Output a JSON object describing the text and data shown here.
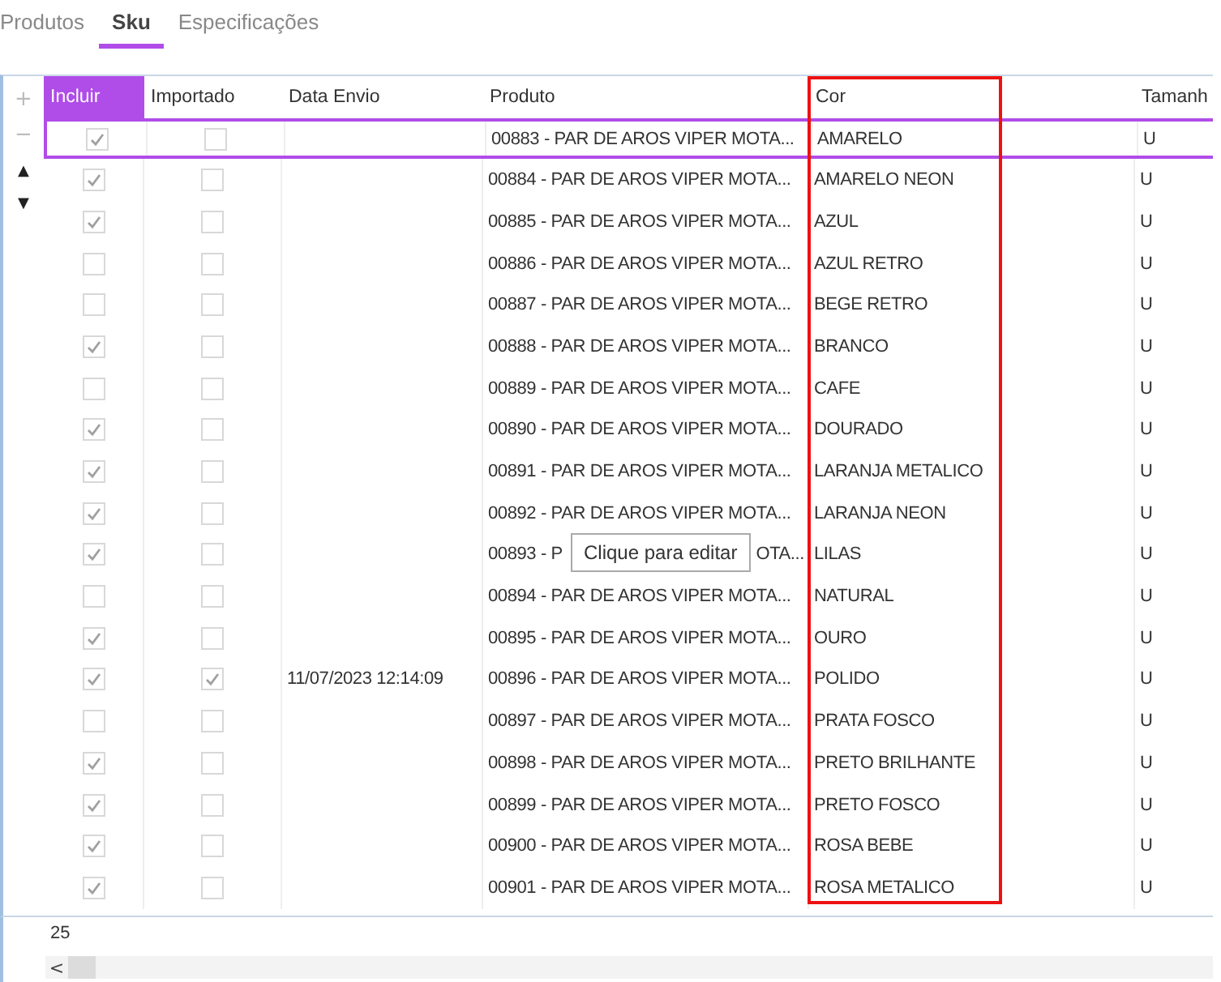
{
  "tabs": [
    {
      "label": "Produtos",
      "selected": false
    },
    {
      "label": "Sku",
      "selected": true
    },
    {
      "label": "Especificações",
      "selected": false
    }
  ],
  "gutter_buttons": [
    {
      "symbol": "+",
      "disabled": true
    },
    {
      "symbol": "−",
      "disabled": true
    },
    {
      "symbol": "▲",
      "disabled": false
    },
    {
      "symbol": "▼",
      "disabled": false
    }
  ],
  "table": {
    "columns": [
      {
        "label": "Incluir",
        "kind": "check",
        "selected": true,
        "framed": false
      },
      {
        "label": "Importado",
        "kind": "check",
        "selected": false,
        "framed": false
      },
      {
        "label": "Data Envio",
        "kind": "text",
        "selected": false,
        "framed": false
      },
      {
        "label": "Produto",
        "kind": "text",
        "selected": false,
        "framed": false
      },
      {
        "label": "Cor",
        "kind": "text",
        "selected": false,
        "framed": true
      },
      {
        "label": "Tamanh",
        "kind": "text",
        "selected": false,
        "framed": false
      }
    ],
    "rows": [
      {
        "selected": true,
        "cells": [
          true,
          false,
          "",
          "00883 - PAR DE AROS VIPER MOTA...",
          "AMARELO",
          "U"
        ]
      },
      {
        "selected": false,
        "cells": [
          true,
          false,
          "",
          "00884 - PAR DE AROS VIPER MOTA...",
          "AMARELO NEON",
          "U"
        ]
      },
      {
        "selected": false,
        "cells": [
          true,
          false,
          "",
          "00885 - PAR DE AROS VIPER MOTA...",
          "AZUL",
          "U"
        ]
      },
      {
        "selected": false,
        "cells": [
          false,
          false,
          "",
          "00886 - PAR DE AROS VIPER MOTA...",
          "AZUL RETRO",
          "U"
        ]
      },
      {
        "selected": false,
        "cells": [
          false,
          false,
          "",
          "00887 - PAR DE AROS VIPER MOTA...",
          "BEGE RETRO",
          "U"
        ]
      },
      {
        "selected": false,
        "cells": [
          true,
          false,
          "",
          "00888 - PAR DE AROS VIPER MOTA...",
          "BRANCO",
          "U"
        ]
      },
      {
        "selected": false,
        "cells": [
          false,
          false,
          "",
          "00889 - PAR DE AROS VIPER MOTA...",
          "CAFE",
          "U"
        ]
      },
      {
        "selected": false,
        "cells": [
          true,
          false,
          "",
          "00890 - PAR DE AROS VIPER MOTA...",
          "DOURADO",
          "U"
        ]
      },
      {
        "selected": false,
        "cells": [
          true,
          false,
          "",
          "00891 - PAR DE AROS VIPER MOTA...",
          "LARANJA METALICO",
          "U"
        ]
      },
      {
        "selected": false,
        "cells": [
          true,
          false,
          "",
          "00892 - PAR DE AROS VIPER MOTA...",
          "LARANJA NEON",
          "U"
        ]
      },
      {
        "selected": false,
        "cells": [
          true,
          false,
          "",
          {
            "before": "00893 - P",
            "after": "OTA..."
          },
          "LILAS",
          "U"
        ]
      },
      {
        "selected": false,
        "cells": [
          false,
          false,
          "",
          "00894 - PAR DE AROS VIPER MOTA...",
          "NATURAL",
          "U"
        ]
      },
      {
        "selected": false,
        "cells": [
          true,
          false,
          "",
          "00895 - PAR DE AROS VIPER MOTA...",
          "OURO",
          "U"
        ]
      },
      {
        "selected": false,
        "cells": [
          true,
          true,
          "11/07/2023 12:14:09",
          "00896 - PAR DE AROS VIPER MOTA...",
          "POLIDO",
          "U"
        ]
      },
      {
        "selected": false,
        "cells": [
          false,
          false,
          "",
          "00897 - PAR DE AROS VIPER MOTA...",
          "PRATA FOSCO",
          "U"
        ]
      },
      {
        "selected": false,
        "cells": [
          true,
          false,
          "",
          "00898 - PAR DE AROS VIPER MOTA...",
          "PRETO BRILHANTE",
          "U"
        ]
      },
      {
        "selected": false,
        "cells": [
          true,
          false,
          "",
          "00899 - PAR DE AROS VIPER MOTA...",
          "PRETO FOSCO",
          "U"
        ]
      },
      {
        "selected": false,
        "cells": [
          true,
          false,
          "",
          "00900 - PAR DE AROS VIPER MOTA...",
          "ROSA BEBE",
          "U"
        ]
      },
      {
        "selected": false,
        "cells": [
          true,
          false,
          "",
          "00901 - PAR DE AROS VIPER MOTA...",
          "ROSA METALICO",
          "U"
        ]
      }
    ]
  },
  "tooltip": {
    "text": "Clique para editar"
  },
  "footer": {
    "count": "25",
    "scroll_left": "<"
  }
}
